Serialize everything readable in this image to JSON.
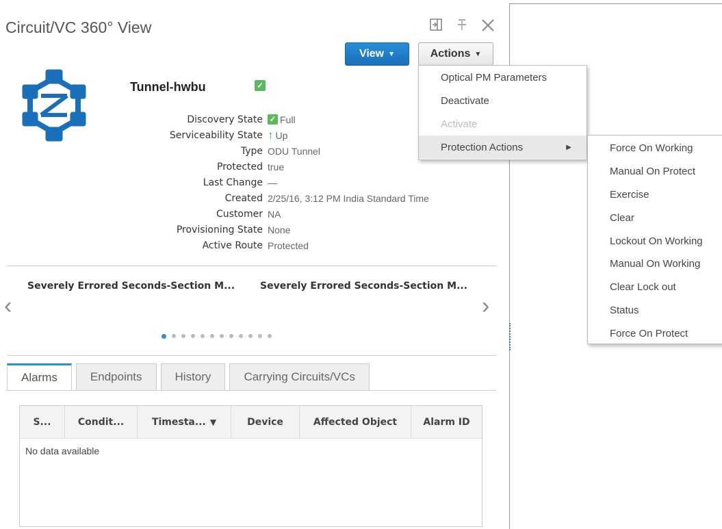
{
  "header": {
    "title": "Circuit/VC 360° View",
    "view_label": "View",
    "actions_label": "Actions"
  },
  "circuit": {
    "name": "Tunnel-hwbu",
    "properties": [
      {
        "key": "Discovery State",
        "value": "Full",
        "icon": "check-icon"
      },
      {
        "key": "Serviceability State",
        "value": "Up",
        "icon": "up-arrow-icon"
      },
      {
        "key": "Type",
        "value": "ODU Tunnel"
      },
      {
        "key": "Protected",
        "value": "true"
      },
      {
        "key": "Last Change",
        "value": "—"
      },
      {
        "key": "Created",
        "value": "2/25/16, 3:12 PM India Standard Time"
      },
      {
        "key": "Customer",
        "value": "NA"
      },
      {
        "key": "Provisioning State",
        "value": "None"
      },
      {
        "key": "Active Route",
        "value": "Protected"
      }
    ]
  },
  "carousel": {
    "items": [
      "Severely Errored Seconds-Section M...",
      "Severely Errored Seconds-Section M..."
    ],
    "dot_count": 12,
    "active_index": 0
  },
  "tabs": [
    "Alarms",
    "Endpoints",
    "History",
    "Carrying Circuits/VCs"
  ],
  "table": {
    "columns": [
      "S...",
      "Condit...",
      "Timesta...",
      "Device",
      "Affected Object",
      "Alarm ID"
    ],
    "sort_indicator": "▼",
    "empty_text": "No data available"
  },
  "actions_menu": {
    "items": [
      "Optical PM Parameters",
      "Deactivate",
      "Activate",
      "Protection Actions"
    ]
  },
  "protection_submenu": {
    "items": [
      "Force On Working",
      "Manual On Protect",
      "Exercise",
      "Clear",
      "Lockout On Working",
      "Manual On Working",
      "Clear Lock out",
      "Status",
      "Force On Protect"
    ]
  },
  "colors": {
    "primary": "#2a8fd8",
    "success": "#5cb85c",
    "icon_blue": "#1a6fba"
  }
}
